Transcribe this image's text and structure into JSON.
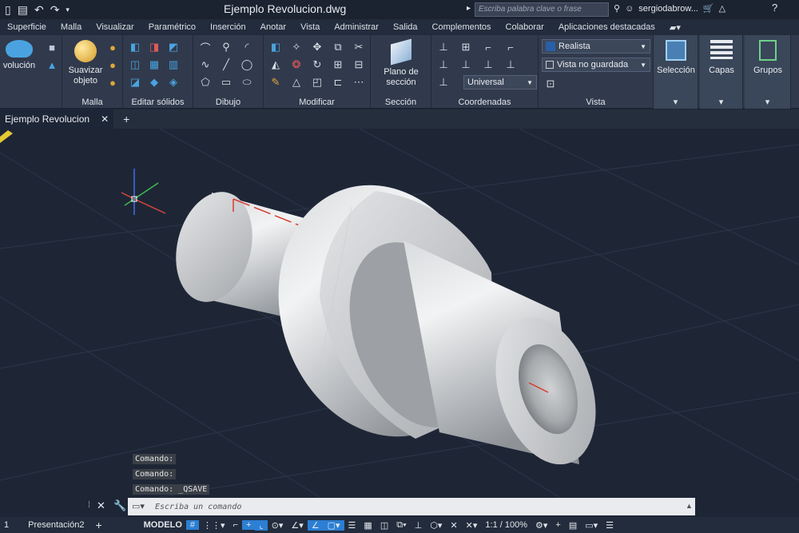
{
  "window": {
    "title": "Ejemplo Revolucion.dwg"
  },
  "search": {
    "placeholder": "Escriba palabra clave o frase"
  },
  "user": {
    "name": "sergiodabrow..."
  },
  "menu": [
    "Superficie",
    "Malla",
    "Visualizar",
    "Paramétrico",
    "Inserción",
    "Anotar",
    "Vista",
    "Administrar",
    "Salida",
    "Complementos",
    "Colaborar",
    "Aplicaciones destacadas"
  ],
  "ribbon": {
    "revolucion": "volución",
    "suavizar": "Suavizar objeto",
    "plano": "Plano de sección",
    "seleccion": "Selección",
    "capas": "Capas",
    "grupos": "Grupos",
    "panels": {
      "malla": "Malla",
      "editar": "Editar sólidos",
      "dibujo": "Dibujo",
      "modificar": "Modificar",
      "seccion": "Sección",
      "coordenadas": "Coordenadas",
      "vista": "Vista"
    },
    "visual_style": "Realista",
    "view": "Vista no guardada",
    "ucs": "Universal"
  },
  "tabs": {
    "doc": "Ejemplo Revolucion",
    "close": "✕",
    "add": "+"
  },
  "command": {
    "history": [
      "Comando:",
      "Comando:",
      "Comando: _QSAVE"
    ],
    "placeholder": "Escriba un comando"
  },
  "status": {
    "layout_tab": "1",
    "presentation": "Presentación2",
    "model": "MODELO",
    "scale": "1:1 / 100%"
  },
  "colors": {
    "background": "#1e2636",
    "ribbon": "#303a4c",
    "accent": "#2b7fd4"
  }
}
